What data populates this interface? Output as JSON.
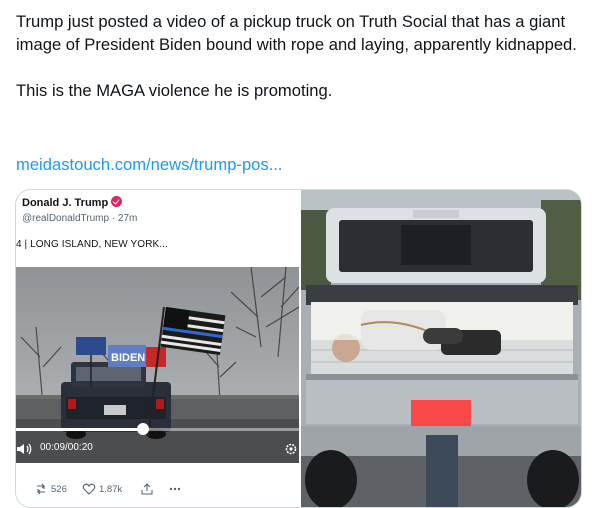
{
  "tweet": {
    "text_line1": "Trump just posted a video of a pickup truck on Truth Social that has a giant image of President Biden bound with rope and laying, apparently kidnapped.",
    "text_line2": "This is the MAGA violence he is promoting.",
    "link": "meidastouch.com/news/trump-pos..."
  },
  "embed": {
    "display_name": "Donald J. Trump",
    "handle_time": "@realDonaldTrump · 27m",
    "text": "4 | LONG ISLAND, NEW YORK...",
    "video": {
      "time": "00:09/00:20",
      "progress": 0.45,
      "flag_text": "BIDEN"
    },
    "actions": {
      "reply_count": "",
      "repost_count": "526",
      "like_count": "1.87k"
    }
  },
  "icons": {
    "verified": "verified-badge-icon",
    "volume": "volume-icon",
    "settings": "settings-gear-icon",
    "repost": "repost-icon",
    "like": "heart-icon",
    "share": "share-icon",
    "more": "more-icon"
  },
  "colors": {
    "link": "#1d9bf0",
    "text": "#0f1419",
    "muted": "#536471",
    "badge": "#e0245e"
  }
}
